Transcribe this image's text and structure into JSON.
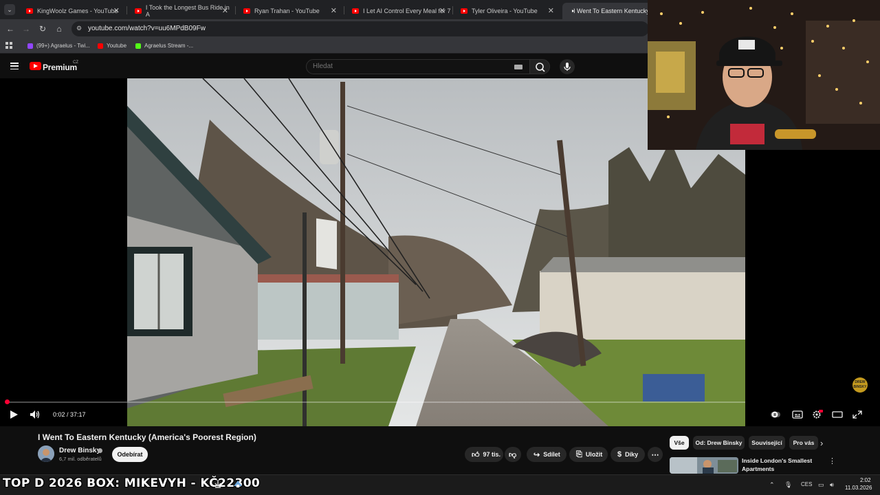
{
  "browser": {
    "tabs": [
      {
        "title": "KingWoolz Games - YouTube"
      },
      {
        "title": "I Took the Longest Bus Ride in A"
      },
      {
        "title": "Ryan Trahan - YouTube"
      },
      {
        "title": "I Let AI Control Every Meal for 7"
      },
      {
        "title": "Tyler Oliveira - YouTube"
      },
      {
        "title": "I Went To Eastern Kentucky (A"
      }
    ],
    "url": "youtube.com/watch?v=uu6MPdB09Fw",
    "bookmarks": [
      {
        "label": "(99+) Agraelus - Twi...",
        "color": "#9146ff"
      },
      {
        "label": "Youtube",
        "color": "#ff0000"
      },
      {
        "label": "Agraelus Stream -...",
        "color": "#53fc18"
      }
    ]
  },
  "masthead": {
    "logo_label": "Premium",
    "region": "CZ",
    "search_placeholder": "Hledat"
  },
  "player": {
    "current_time": "0:02",
    "duration": "37:17",
    "time_display": "0:02 / 37:17",
    "progress_fraction": 0.0009,
    "watermark": "DREW BINSKY"
  },
  "video": {
    "title": "I Went To Eastern Kentucky (America's Poorest Region)",
    "channel_name": "Drew Binsky",
    "subscribers": "6,7 mil. odběratelů",
    "subscribe_label": "Odebírat",
    "likes": "97 tis.",
    "share_label": "Sdílet",
    "save_label": "Uložit",
    "thanks_label": "Díky"
  },
  "related": {
    "chips": [
      "Vše",
      "Od: Drew Binsky",
      "Související",
      "Pro vás"
    ],
    "first_video_title": "Inside London's Smallest Apartments"
  },
  "taskbar": {
    "ticker": "TOP D 2026 BOX: MIKEVYH - KČ22300",
    "language": "CES",
    "time": "2:02",
    "date": "11.03.2026"
  },
  "colors": {
    "accent": "#ff0033",
    "youtube_red": "#ff0000",
    "background": "#0f0f0f"
  }
}
